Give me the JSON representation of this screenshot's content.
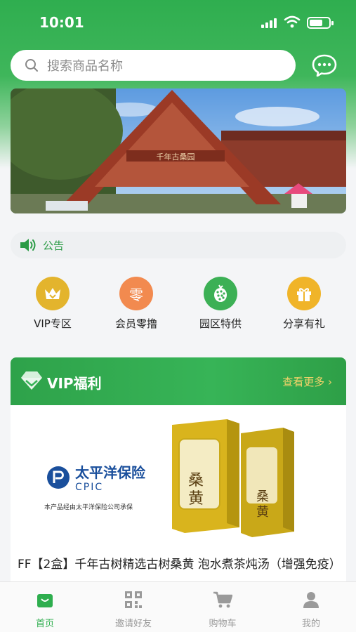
{
  "status_bar": {
    "time": "10:01"
  },
  "search": {
    "placeholder": "搜索商品名称"
  },
  "notice": {
    "label": "公告"
  },
  "categories": [
    {
      "label": "VIP专区",
      "icon": "crown-icon",
      "color": "#e3b42d"
    },
    {
      "label": "会员零撸",
      "icon": "zero-icon",
      "color": "#f28a4f"
    },
    {
      "label": "园区特供",
      "icon": "berry-icon",
      "color": "#3cb055"
    },
    {
      "label": "分享有礼",
      "icon": "gift-icon",
      "color": "#f0b429"
    }
  ],
  "vip_section": {
    "title": "VIP福利",
    "more": "查看更多",
    "product": {
      "insurer_name": "太平洋保险",
      "insurer_en": "CPIC",
      "insurer_note": "本产品经由太平洋保险公司承保",
      "box_text": "桑黄",
      "title": "FF【2盒】千年古树精选古树桑黄 泡水煮茶炖汤（增强免疫）"
    }
  },
  "tabbar": [
    {
      "label": "首页",
      "icon": "home-bag-icon",
      "active": true
    },
    {
      "label": "邀请好友",
      "icon": "qr-code-icon",
      "active": false
    },
    {
      "label": "购物车",
      "icon": "cart-icon",
      "active": false
    },
    {
      "label": "我的",
      "icon": "user-icon",
      "active": false
    }
  ],
  "colors": {
    "brand_green": "#2eae4e",
    "accent_gold": "#f3d36a"
  }
}
